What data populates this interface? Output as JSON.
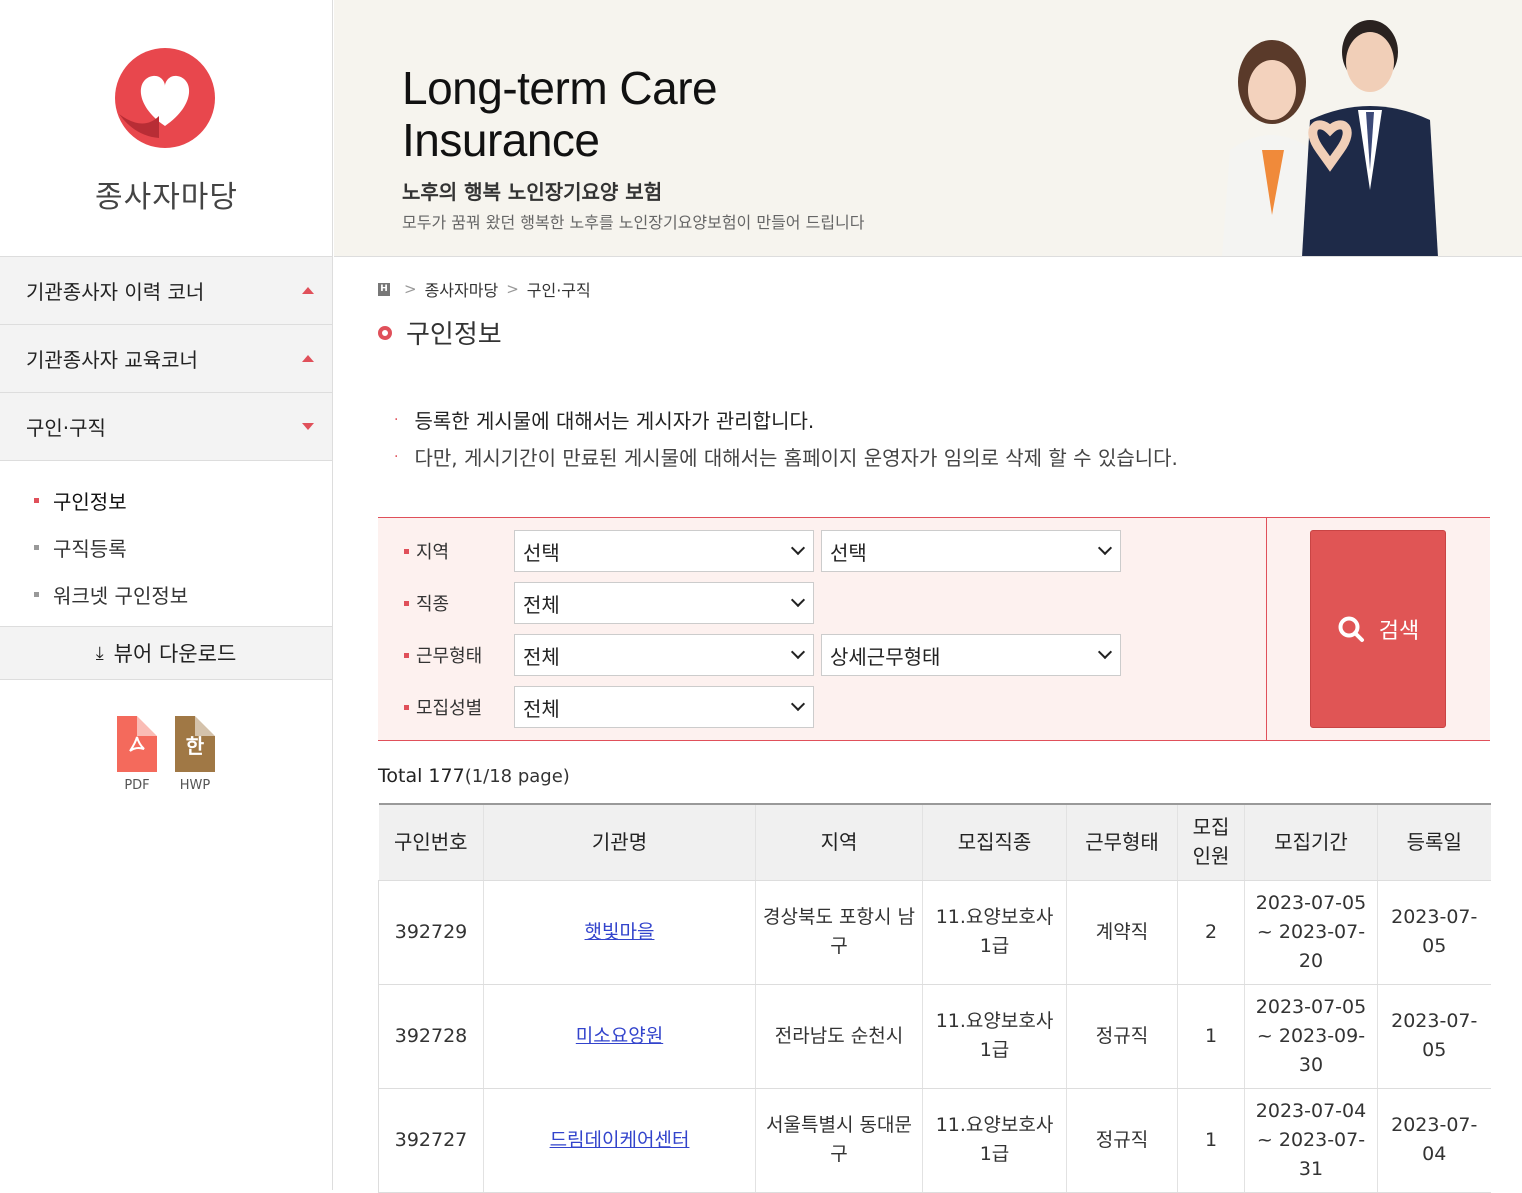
{
  "sidebar": {
    "logo_text": "종사자마당",
    "menu": [
      {
        "label": "기관종사자 이력 코너",
        "state": "collapsed"
      },
      {
        "label": "기관종사자 교육코너",
        "state": "collapsed"
      },
      {
        "label": "구인·구직",
        "state": "expanded"
      }
    ],
    "submenu": [
      {
        "label": "구인정보",
        "active": true
      },
      {
        "label": "구직등록",
        "active": false
      },
      {
        "label": "워크넷 구인정보",
        "active": false
      }
    ],
    "viewer_download": "뷰어 다운로드",
    "files": [
      {
        "label": "PDF",
        "icon": "pdf-file-icon",
        "color": "#f46a5c"
      },
      {
        "label": "HWP",
        "icon": "hwp-file-icon",
        "glyph": "한",
        "color": "#a07845"
      }
    ]
  },
  "banner": {
    "title_line1": "Long-term Care",
    "title_line2": "Insurance",
    "subtitle": "노후의 행복 노인장기요양 보험",
    "description": "모두가 꿈꿔 왔던 행복한 노후를 노인장기요양보험이 만들어 드립니다"
  },
  "breadcrumb": {
    "home": "H",
    "items": [
      "종사자마당",
      "구인·구직"
    ]
  },
  "page_title": "구인정보",
  "notes": [
    "등록한 게시물에 대해서는 게시자가 관리합니다.",
    "다만, 게시기간이 만료된 게시물에 대해서는 홈페이지 운영자가 임의로 삭제 할 수 있습니다."
  ],
  "search": {
    "region_label": "지역",
    "region_value": "선택",
    "region_detail_value": "선택",
    "job_label": "직종",
    "job_value": "전체",
    "worktype_label": "근무형태",
    "worktype_value": "전체",
    "worktype_detail_value": "상세근무형태",
    "gender_label": "모집성별",
    "gender_value": "전체",
    "button_label": "검색"
  },
  "total": {
    "label": "Total 177",
    "page": "(1/18 page)"
  },
  "table": {
    "headers": [
      "구인번호",
      "기관명",
      "지역",
      "모집직종",
      "근무형태",
      "모집\n인원",
      "모집기간",
      "등록일"
    ],
    "rows": [
      [
        "392729",
        "햇빛마을",
        "경상북도 포항시 남구",
        "11.요양보호사 1급",
        "계약직",
        "2",
        "2023-07-05 ~ 2023-07-20",
        "2023-07-05"
      ],
      [
        "392728",
        "미소요양원",
        "전라남도 순천시",
        "11.요양보호사 1급",
        "정규직",
        "1",
        "2023-07-05 ~ 2023-09-30",
        "2023-07-05"
      ],
      [
        "392727",
        "드림데이케어센터",
        "서울특별시 동대문구",
        "11.요양보호사 1급",
        "정규직",
        "1",
        "2023-07-04 ~ 2023-07-31",
        "2023-07-04"
      ]
    ]
  },
  "colors": {
    "accent": "#e0505a",
    "link": "#3344cc",
    "search_bg": "#fdf1ef"
  }
}
